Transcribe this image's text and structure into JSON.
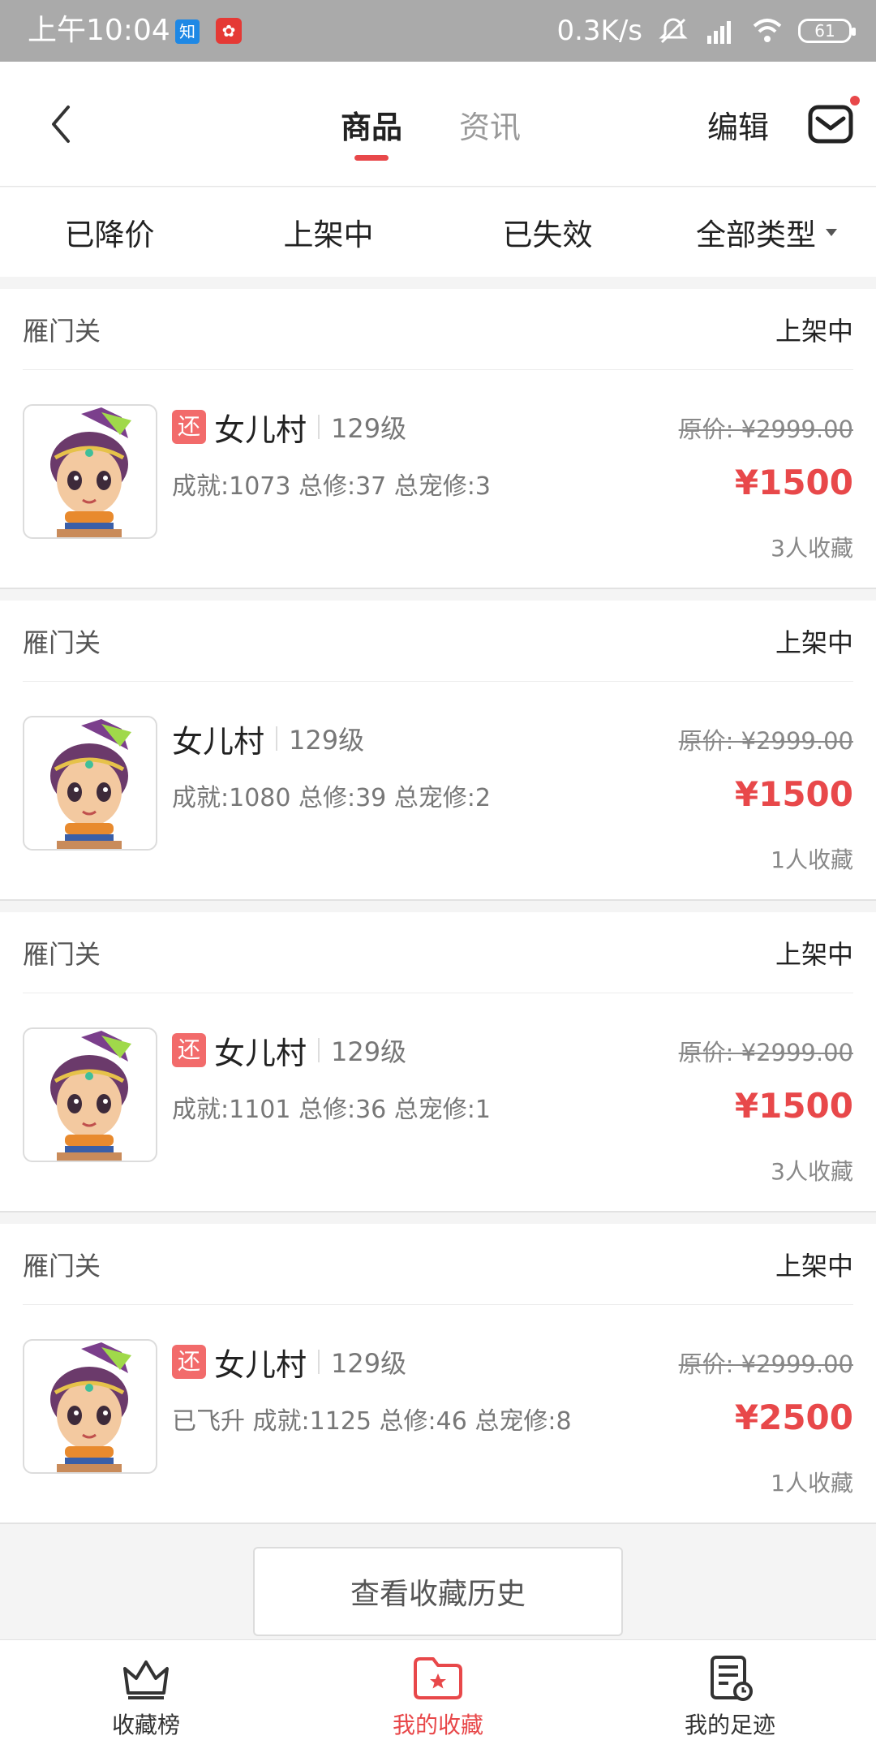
{
  "status_bar": {
    "time": "上午10:04",
    "app1": "知",
    "network_speed": "0.3K/s",
    "battery": "61"
  },
  "header": {
    "tabs": [
      {
        "label": "商品",
        "active": true
      },
      {
        "label": "资讯",
        "active": false
      }
    ],
    "edit_label": "编辑",
    "accent_color": "#e8484a"
  },
  "filters": [
    "已降价",
    "上架中",
    "已失效",
    "全部类型"
  ],
  "items": [
    {
      "server": "雁门关",
      "status": "上架中",
      "badge": "还",
      "school": "女儿村",
      "level": "129级",
      "stats": "成就:1073 总修:37 总宠修:3",
      "original_price": "原价: ¥2999.00",
      "price": "¥1500",
      "fav_count": "3人收藏"
    },
    {
      "server": "雁门关",
      "status": "上架中",
      "badge": "",
      "school": "女儿村",
      "level": "129级",
      "stats": "成就:1080 总修:39 总宠修:2",
      "original_price": "原价: ¥2999.00",
      "price": "¥1500",
      "fav_count": "1人收藏"
    },
    {
      "server": "雁门关",
      "status": "上架中",
      "badge": "还",
      "school": "女儿村",
      "level": "129级",
      "stats": "成就:1101 总修:36 总宠修:1",
      "original_price": "原价: ¥2999.00",
      "price": "¥1500",
      "fav_count": "3人收藏"
    },
    {
      "server": "雁门关",
      "status": "上架中",
      "badge": "还",
      "school": "女儿村",
      "level": "129级",
      "stats": "已飞升 成就:1125 总修:46 总宠修:8",
      "original_price": "原价: ¥2999.00",
      "price": "¥2500",
      "fav_count": "1人收藏"
    }
  ],
  "history_button": "查看收藏历史",
  "bottom_nav": [
    {
      "label": "收藏榜",
      "icon": "crown-icon",
      "active": false
    },
    {
      "label": "我的收藏",
      "icon": "folder-star-icon",
      "active": true
    },
    {
      "label": "我的足迹",
      "icon": "history-doc-icon",
      "active": false
    }
  ]
}
